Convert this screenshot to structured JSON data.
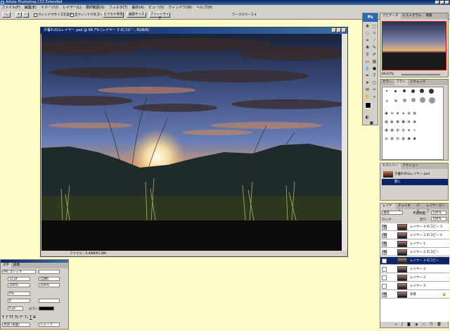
{
  "app": {
    "title": "Adobe Photoshop CS3 Extended"
  },
  "menu": [
    "ファイル(F)",
    "編集(E)",
    "イメージ(I)",
    "レイヤー(L)",
    "選択範囲(S)",
    "フィルタ(T)",
    "解析(A)",
    "ビュー(V)",
    "ウィンドウ(W)",
    "ヘルプ(H)"
  ],
  "options": {
    "resize_windows": "ウィンドウサイズを変更",
    "zoom_all": "全ウィンドウをズーム",
    "actual_pixels": "ピクセル等倍",
    "fit_screen": "画面サイズ",
    "print_size": "プリントサイズ",
    "workspace": "ワークスペース ▾"
  },
  "toolbox": {
    "logo": "Ps"
  },
  "document": {
    "title": "夕暮れの山レイヤー.psd @ 66.7% (レイヤー 3 のコピー, RGB/8)",
    "status": "ファイル : 5.49M/61.8M"
  },
  "navigator": {
    "tabs": [
      "ナビゲータ",
      "ヒストグラム",
      "情報"
    ],
    "zoom": "66.67%"
  },
  "brushes": {
    "tabs": [
      "カラー",
      "ブラシ",
      "スウォッチ"
    ]
  },
  "history": {
    "tabs": [
      "ヒストリー",
      "アクション"
    ],
    "items": [
      "夕暮れの山レイヤー.psd",
      "開く"
    ]
  },
  "layers": {
    "tabs": [
      "レイヤー",
      "チャンネル",
      "パス",
      "レイヤーカンプ"
    ],
    "blend_mode": "通常",
    "opacity_label": "不透明度:",
    "opacity": "100%",
    "lock_label": "ロック:",
    "fill_label": "塗り:",
    "fill": "100%",
    "items": [
      {
        "name": "レイヤー 4 のコピー 3",
        "visible": true,
        "selected": false
      },
      {
        "name": "レイヤー 3 のコピー 4",
        "visible": true,
        "selected": false
      },
      {
        "name": "レイヤー 1",
        "visible": true,
        "selected": false
      },
      {
        "name": "レイヤー 2 のコピー",
        "visible": true,
        "selected": false
      },
      {
        "name": "レイヤー 3 のコピー",
        "visible": true,
        "selected": true
      },
      {
        "name": "レイヤー 4",
        "visible": false,
        "selected": false
      },
      {
        "name": "レイヤー 3",
        "visible": false,
        "selected": false
      },
      {
        "name": "レイヤー 2",
        "visible": false,
        "selected": false
      },
      {
        "name": "背景",
        "visible": true,
        "selected": false
      }
    ]
  },
  "character": {
    "tabs": [
      "文字",
      "段落"
    ],
    "font": "MS ゴシック",
    "size": "12 pt",
    "leading": "(自動)",
    "vscale": "100%",
    "hscale": "100%",
    "tracking": "0%",
    "kerning": "0",
    "baseline": "0 pt",
    "color_label": "カラー :",
    "lang": "英語 (米国)",
    "aa": "シャープ"
  }
}
